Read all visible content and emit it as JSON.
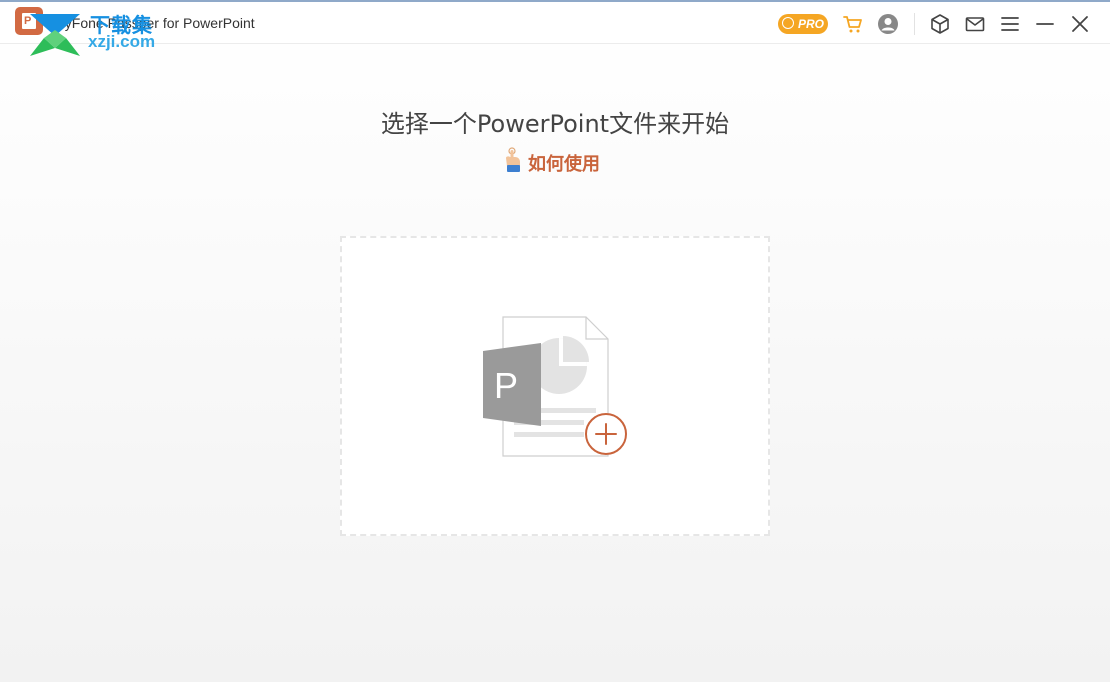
{
  "window": {
    "app_title": "iMyFone Passper for PowerPoint",
    "logo_letter": "P",
    "pro_label": "PRO",
    "icons": {
      "cart": "cart-icon",
      "account": "account-icon",
      "product": "box-icon",
      "mail": "mail-icon",
      "menu": "menu-icon",
      "minimize": "minimize-icon",
      "close": "close-icon"
    }
  },
  "watermark": {
    "top_text": "下载集",
    "bottom_text": "xzji.com"
  },
  "main": {
    "heading": "选择一个PowerPoint文件来开始",
    "howto_label": "如何使用",
    "file_badge_letter": "P"
  },
  "colors": {
    "accent": "#c9643c",
    "pro": "#f5a623",
    "watermark_blue": "#1690e1",
    "watermark_green": "#2ebd59"
  }
}
